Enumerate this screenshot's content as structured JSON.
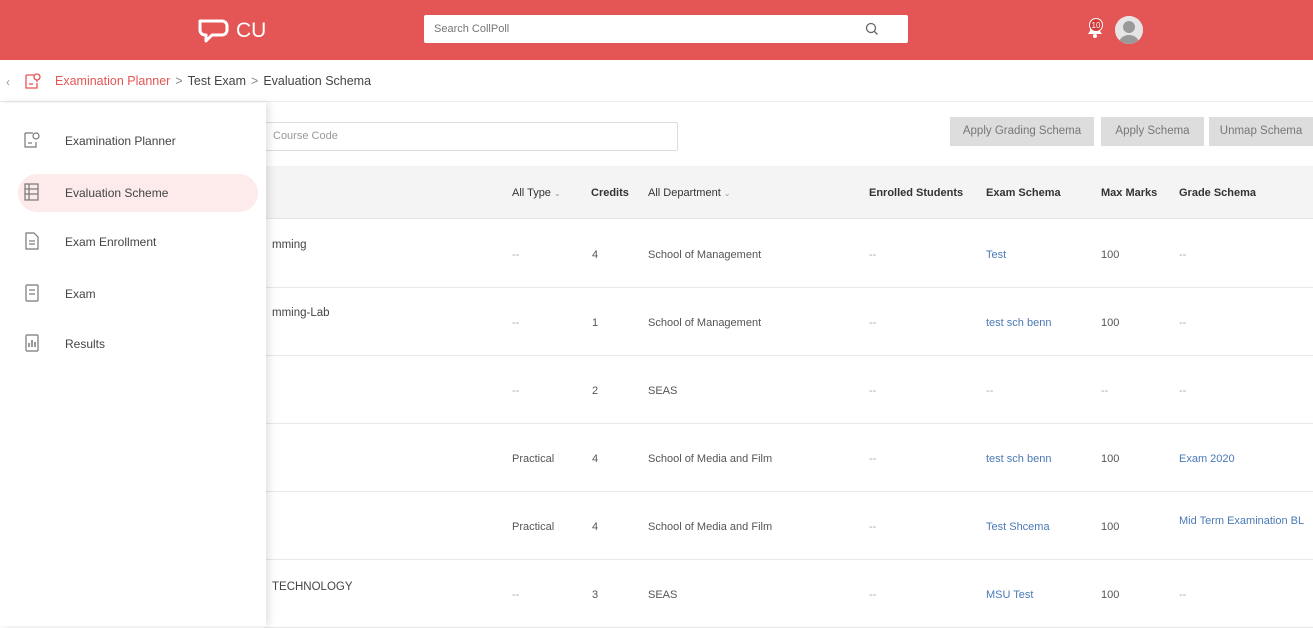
{
  "header": {
    "logo_text": "CU",
    "search_placeholder": "Search CollPoll",
    "notification_count": "10",
    "brand_color": "#e45555"
  },
  "breadcrumb": {
    "back": "‹",
    "items": [
      "Examination Planner",
      "Test Exam",
      "Evaluation Schema"
    ],
    "separator": ">"
  },
  "toolbar": {
    "course_placeholder": "Course Code",
    "apply_grading_label": "Apply Grading Schema",
    "apply_schema_label": "Apply Schema",
    "unmap_schema_label": "Unmap Schema"
  },
  "sidebar": {
    "items": [
      {
        "label": "Examination Planner",
        "icon": "planner-icon"
      },
      {
        "label": "Evaluation Scheme",
        "icon": "schema-icon"
      },
      {
        "label": "Exam Enrollment",
        "icon": "enrollment-icon"
      },
      {
        "label": "Exam",
        "icon": "exam-icon"
      },
      {
        "label": "Results",
        "icon": "results-icon"
      }
    ]
  },
  "table": {
    "headers": {
      "type": "All Type",
      "credits": "Credits",
      "department": "All Department",
      "enrolled": "Enrolled Students",
      "exam_schema": "Exam Schema",
      "max_marks": "Max Marks",
      "grade_schema": "Grade Schema"
    },
    "rows": [
      {
        "name": "mming",
        "type": "--",
        "credits": "4",
        "department": "School of Management",
        "enrolled": "--",
        "exam_schema": "Test",
        "max_marks": "100",
        "grade_schema": "--"
      },
      {
        "name": "mming-Lab",
        "type": "--",
        "credits": "1",
        "department": "School of Management",
        "enrolled": "--",
        "exam_schema": "test sch benn",
        "max_marks": "100",
        "grade_schema": "--"
      },
      {
        "name": "",
        "type": "--",
        "credits": "2",
        "department": "SEAS",
        "enrolled": "--",
        "exam_schema": "--",
        "max_marks": "--",
        "grade_schema": "--"
      },
      {
        "name": "",
        "type": "Practical",
        "credits": "4",
        "department": "School of Media and Film",
        "enrolled": "--",
        "exam_schema": "test sch benn",
        "max_marks": "100",
        "grade_schema": "Exam 2020"
      },
      {
        "name": "",
        "type": "Practical",
        "credits": "4",
        "department": "School of Media and Film",
        "enrolled": "--",
        "exam_schema": "Test Shcema",
        "max_marks": "100",
        "grade_schema": "Mid Term Examination BL"
      },
      {
        "name": "TECHNOLOGY",
        "type": "--",
        "credits": "3",
        "department": "SEAS",
        "enrolled": "--",
        "exam_schema": "MSU Test",
        "max_marks": "100",
        "grade_schema": "--"
      }
    ]
  }
}
